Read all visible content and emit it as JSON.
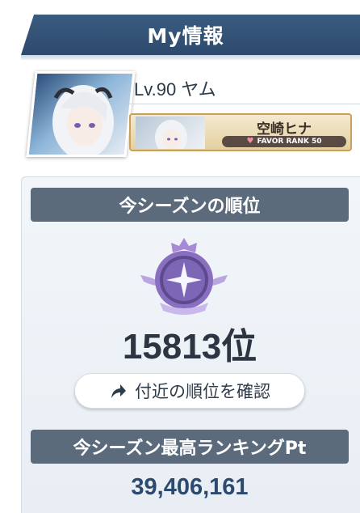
{
  "header": {
    "title": "My情報"
  },
  "profile": {
    "level_name": "Lv.90 ヤム",
    "favor_student": "空崎ヒナ",
    "favor_rank": "FAVOR RANK 50"
  },
  "season_rank": {
    "header": "今シーズンの順位",
    "value": "15813位",
    "nearby_button": "付近の順位を確認"
  },
  "season_best": {
    "header": "今シーズン最高ランキングPt",
    "value": "39,406,161"
  },
  "icons": {
    "emblem": "rank-emblem-icon",
    "button": "share-arrow-icon",
    "favor": "heart-icon"
  },
  "colors": {
    "banner": "#2c4a6d",
    "section_header": "#5b6b7c",
    "favor_border": "#c9a15a",
    "emblem": "#8a6fc0"
  }
}
